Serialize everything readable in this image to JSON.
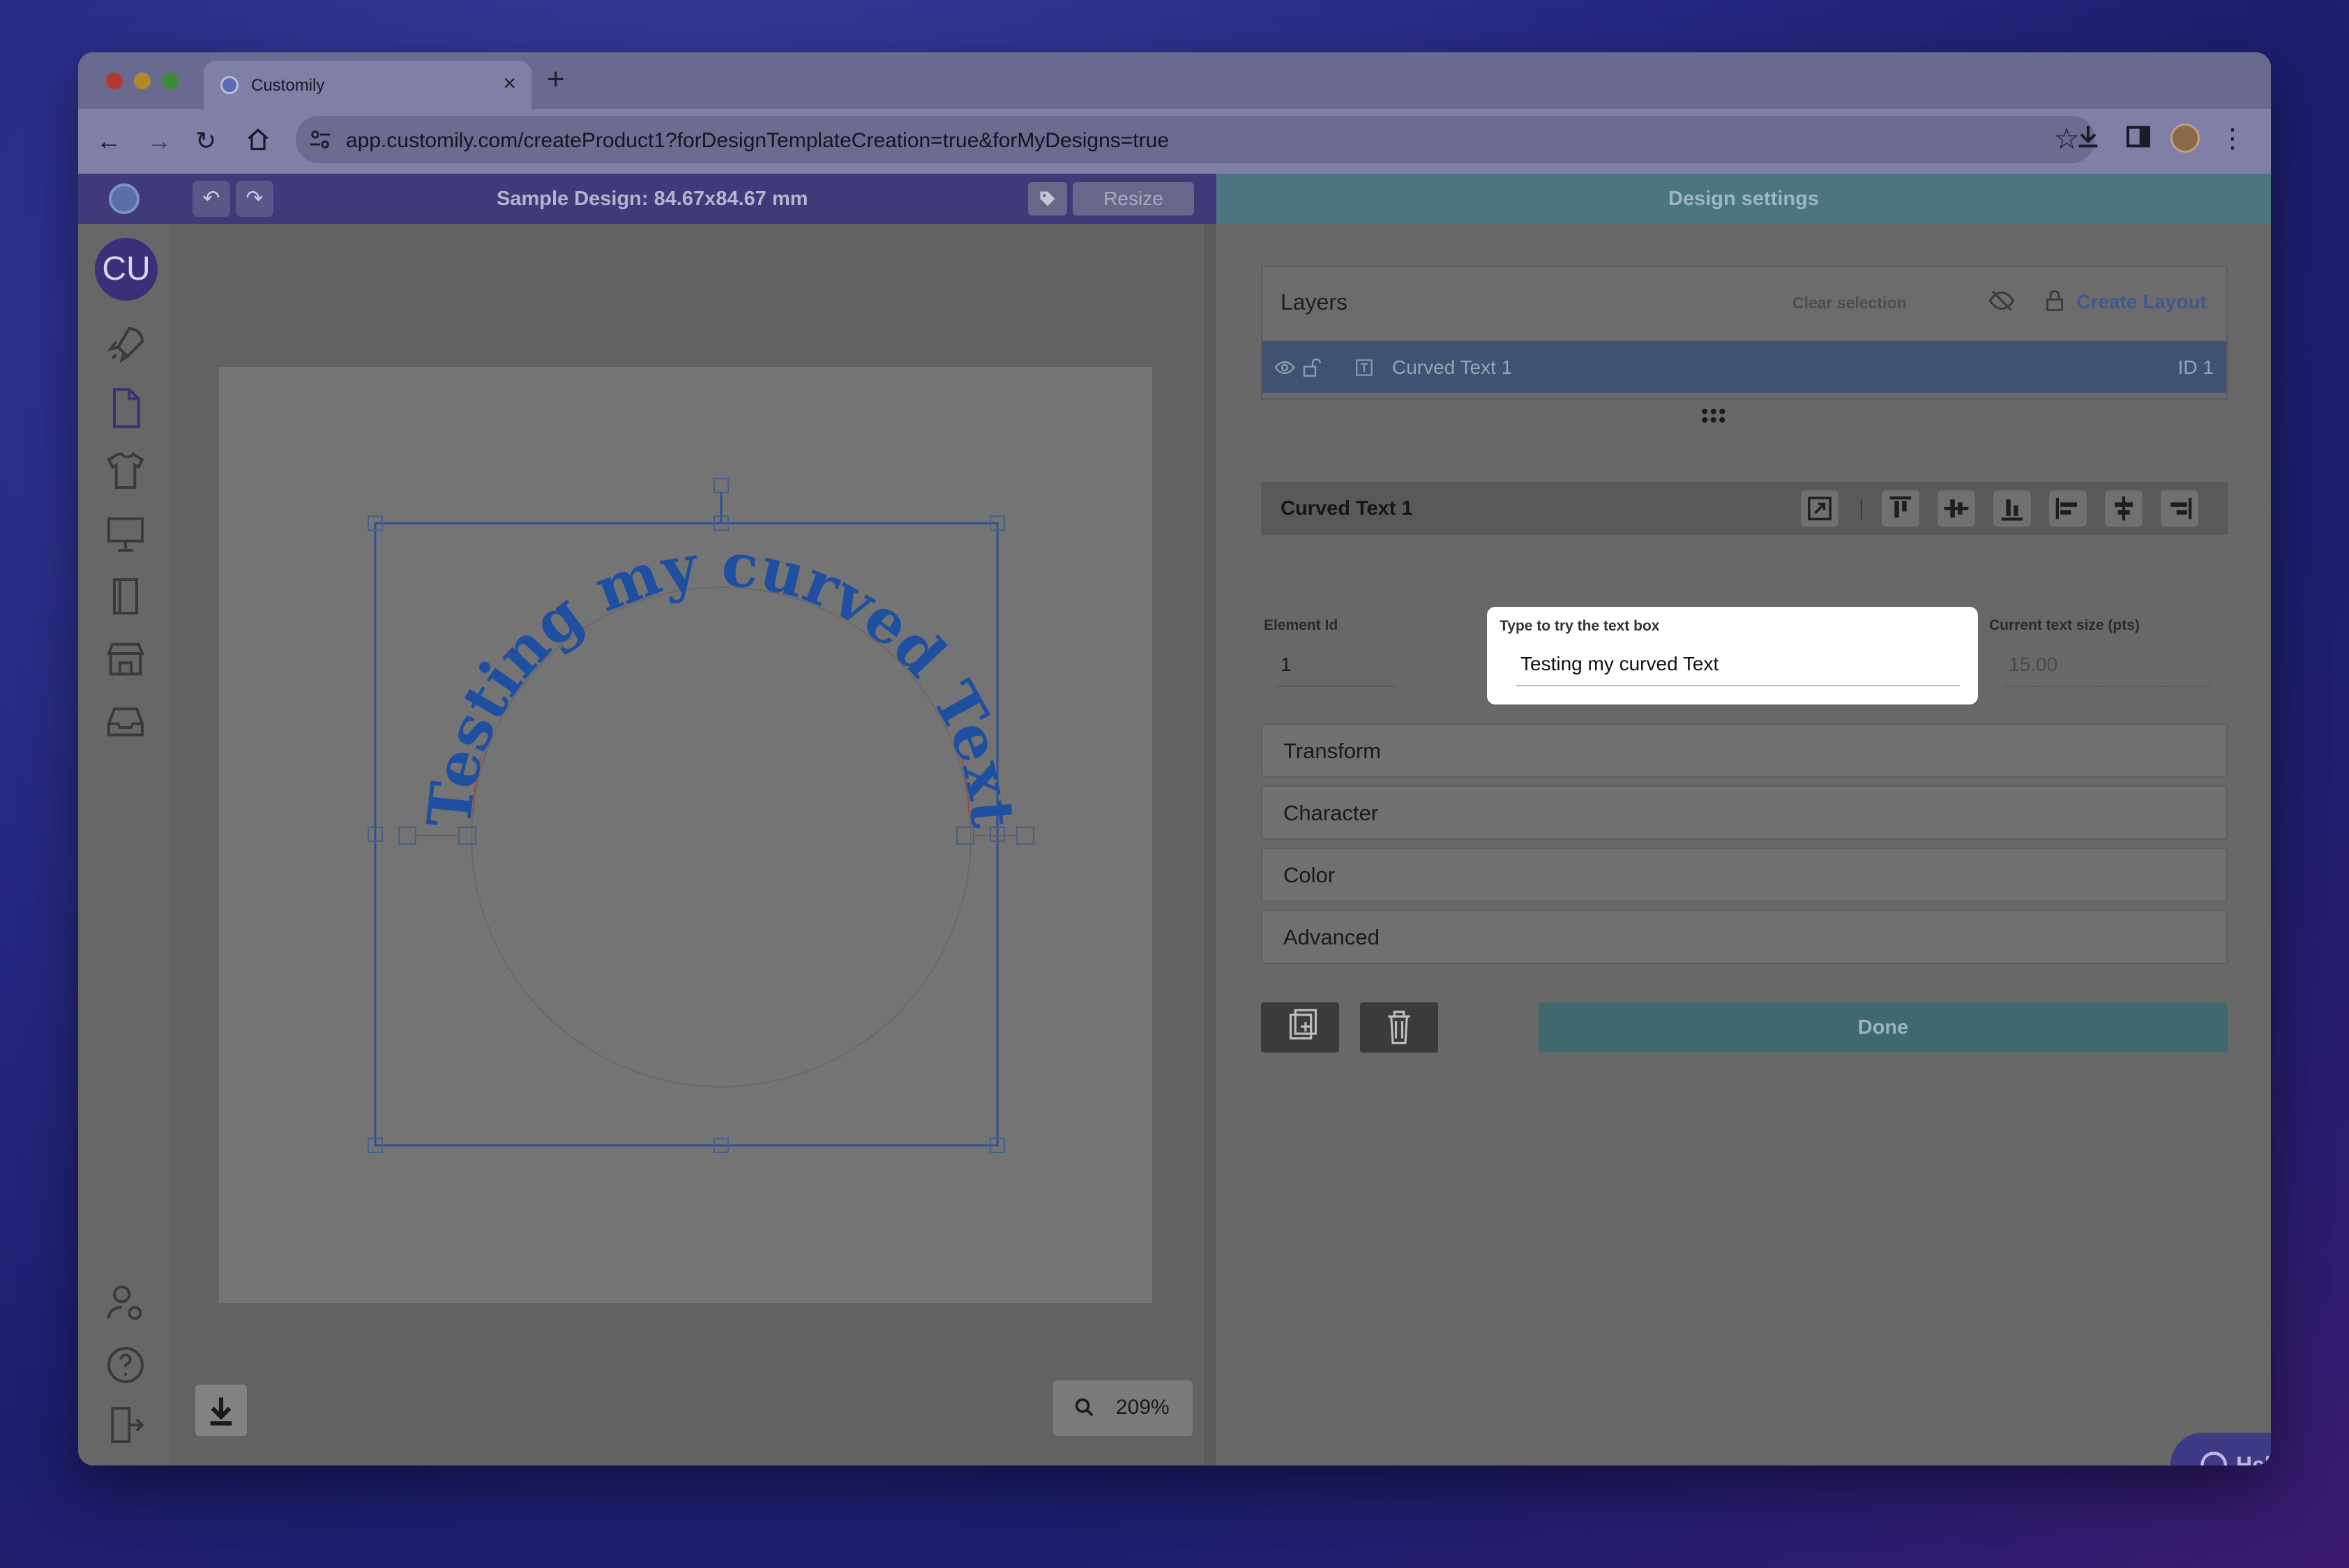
{
  "browser": {
    "tab_title": "Customily",
    "new_tab_glyph": "+",
    "url": "app.customily.com/createProduct1?forDesignTemplateCreation=true&forMyDesigns=true"
  },
  "toolbar": {
    "undo_glyph": "↶",
    "redo_glyph": "↷",
    "design_title": "Sample Design: 84.67x84.67 mm",
    "resize_label": "Resize",
    "panel_title": "Design settings"
  },
  "sidebar": {
    "avatar_initials": "CU"
  },
  "canvas": {
    "curved_text": "Testing my curved Text",
    "zoom_level": "209%"
  },
  "layers": {
    "header": "Layers",
    "clear_selection": "Clear selection",
    "create_layout": "Create Layout",
    "items": [
      {
        "name": "Curved Text 1",
        "id_label": "ID 1"
      }
    ]
  },
  "element_panel": {
    "title": "Curved Text 1",
    "element_id_label": "Element Id",
    "element_id_value": "1",
    "text_box_label": "Type to try the text box",
    "text_box_value": "Testing my curved Text",
    "text_size_label": "Current text size (pts)",
    "text_size_value": "15.00",
    "sections": [
      "Transform",
      "Character",
      "Color",
      "Advanced"
    ],
    "done_label": "Done"
  },
  "help": {
    "label": "Help"
  },
  "colors": {
    "accent": "#3f5a8e",
    "curve_text": "#1f4fa0",
    "done": "#40696f"
  }
}
